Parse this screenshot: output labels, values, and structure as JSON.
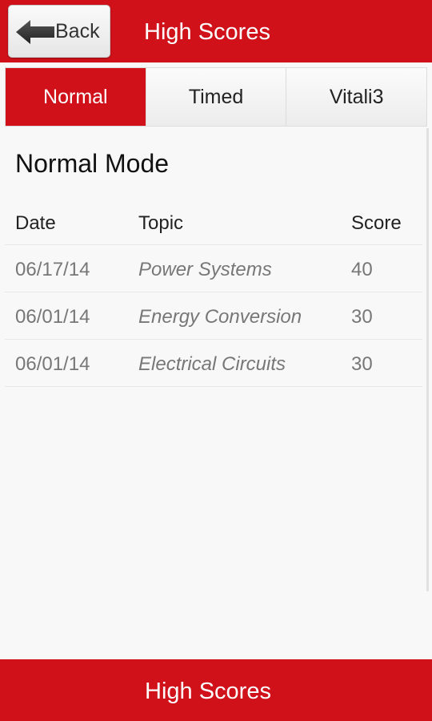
{
  "header": {
    "back_label": "Back",
    "title": "High Scores"
  },
  "tabs": [
    {
      "label": "Normal",
      "active": true
    },
    {
      "label": "Timed",
      "active": false
    },
    {
      "label": "Vitali3",
      "active": false
    }
  ],
  "section_title": "Normal Mode",
  "table": {
    "headers": {
      "date": "Date",
      "topic": "Topic",
      "score": "Score"
    },
    "rows": [
      {
        "date": "06/17/14",
        "topic": "Power Systems",
        "score": "40"
      },
      {
        "date": "06/01/14",
        "topic": "Energy Conversion",
        "score": "30"
      },
      {
        "date": "06/01/14",
        "topic": "Electrical Circuits",
        "score": "30"
      }
    ]
  },
  "footer": {
    "title": "High Scores"
  },
  "colors": {
    "accent": "#d0111a"
  },
  "icons": {
    "back": "back-arrow-icon"
  }
}
